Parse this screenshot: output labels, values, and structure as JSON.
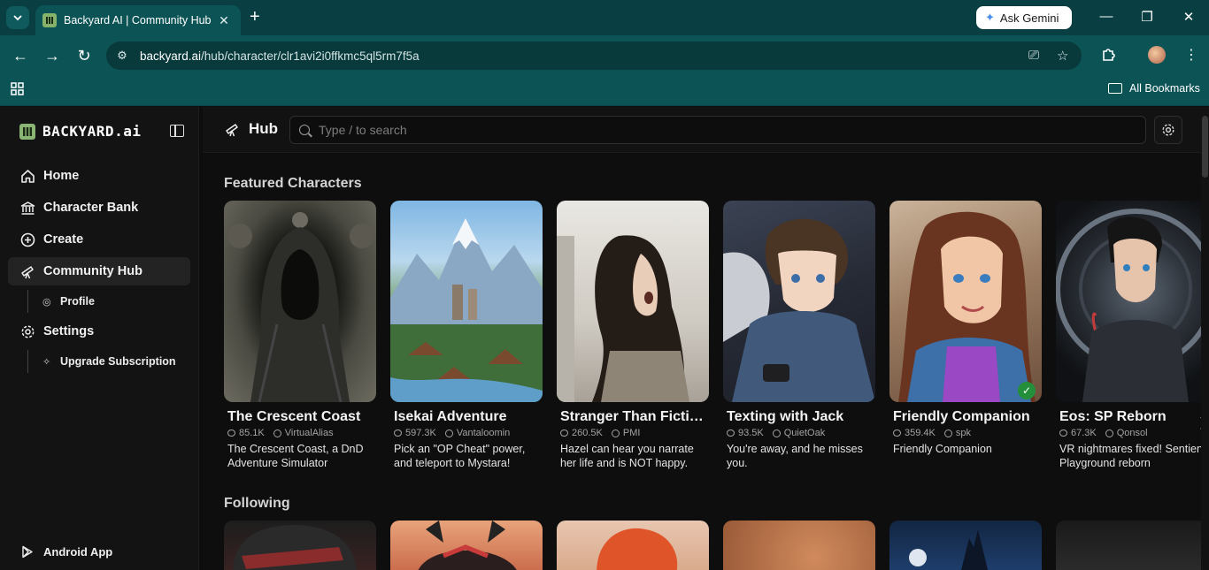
{
  "browser": {
    "tab_title": "Backyard AI | Community Hub",
    "url_host": "backyard.ai",
    "url_path": "/hub/character/clr1avi2i0ffkmc5ql5rm7f5a",
    "ask_gemini": "Ask Gemini",
    "all_bookmarks": "All Bookmarks"
  },
  "sidebar": {
    "logo_text": "BACKYARD.ai",
    "items": [
      {
        "label": "Home",
        "icon": "home-icon"
      },
      {
        "label": "Character Bank",
        "icon": "bank-icon"
      },
      {
        "label": "Create",
        "icon": "plus-circle-icon"
      },
      {
        "label": "Community Hub",
        "icon": "telescope-icon",
        "active": true
      },
      {
        "label": "Settings",
        "icon": "gear-icon"
      }
    ],
    "sub_profile": "Profile",
    "sub_upgrade": "Upgrade Subscription",
    "android": "Android App"
  },
  "header": {
    "title": "Hub",
    "search_placeholder": "Type / to search"
  },
  "sections": {
    "featured": "Featured Characters",
    "following": "Following"
  },
  "featured": [
    {
      "name": "The Crescent Coast",
      "chats": "85.1K",
      "author": "VirtualAlias",
      "desc": "The Crescent Coast, a DnD Adventure Simulator"
    },
    {
      "name": "Isekai Adventure",
      "chats": "597.3K",
      "author": "Vantaloomin",
      "desc": "Pick an \"OP Cheat\" power, and teleport to Mystara!"
    },
    {
      "name": "Stranger Than Ficti…",
      "chats": "260.5K",
      "author": "PMI",
      "desc": "Hazel can hear you narrate her life and is NOT happy."
    },
    {
      "name": "Texting with Jack",
      "chats": "93.5K",
      "author": "QuietOak",
      "desc": "You're away, and he misses you."
    },
    {
      "name": "Friendly Companion",
      "chats": "359.4K",
      "author": "spk",
      "desc": "Friendly Companion",
      "verified": true
    },
    {
      "name": "Eos: SP Reborn",
      "chats": "67.3K",
      "author": "Qonsol",
      "desc": "VR nightmares fixed! Sentient Playground reborn"
    }
  ]
}
